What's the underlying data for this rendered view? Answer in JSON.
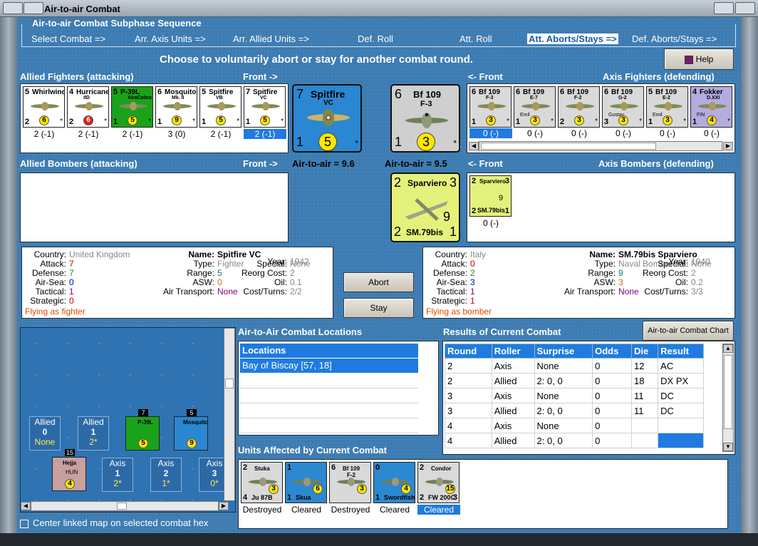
{
  "window": {
    "title": "Air-to-air Combat"
  },
  "sequence": {
    "title": "Air-to-air Combat Subphase Sequence",
    "steps": [
      "Select Combat =>",
      "Arr. Axis Units =>",
      "Arr. Allied Units =>",
      "Def. Roll",
      "Att. Roll",
      "Att. Aborts/Stays =>",
      "Def. Aborts/Stays =>"
    ]
  },
  "prompt": "Choose to voluntarily abort or stay for another combat round.",
  "help_label": "Help",
  "allied_fighters": {
    "title": "Allied Fighters (attacking)",
    "front": "Front ->",
    "units": [
      {
        "tl": "5",
        "name": "Whirlwind",
        "bl": "2",
        "rating": "6",
        "under": "2 (-1)",
        "color": "#ffffff",
        "dot": "yellow"
      },
      {
        "tl": "4",
        "name": "Hurricane",
        "sub": "IID",
        "bl": "2",
        "rating": "6",
        "under": "2 (-1)",
        "color": "#ffffff",
        "dot": "red"
      },
      {
        "tl": "5",
        "name": "P-39L",
        "sub": "AiraCobra",
        "bl": "1",
        "rating": "5",
        "under": "2 (-1)",
        "color": "#1aa31a",
        "dot": "yellow"
      },
      {
        "tl": "6",
        "name": "Mosquito",
        "sub": "Mk. II",
        "bl": "1",
        "rating": "9",
        "under": "3 (0)",
        "color": "#ffffff",
        "dot": "yellow"
      },
      {
        "tl": "5",
        "name": "Spitfire",
        "sub": "VB",
        "bl": "1",
        "rating": "5",
        "under": "2 (-1)",
        "color": "#ffffff",
        "dot": "yellow"
      },
      {
        "tl": "7",
        "name": "Spitfire",
        "sub": "VC",
        "bl": "1",
        "rating": "5",
        "under": "2 (-1)",
        "color": "#ffffff",
        "dot": "yellow"
      }
    ]
  },
  "allied_selected": {
    "tl": "7",
    "name": "Spitfire",
    "sub": "VC",
    "bl": "1",
    "rating": "5",
    "a2a": "Air-to-air = 9.6"
  },
  "axis_selected": {
    "tl": "6",
    "name": "Bf 109",
    "sub": "F-3",
    "bl": "1",
    "rating": "3",
    "a2a": "Air-to-air = 9.5"
  },
  "axis_fighters": {
    "title": "Axis Fighters (defending)",
    "front": "<- Front",
    "units": [
      {
        "tl": "6",
        "name": "Bf 109",
        "sub": "F-3",
        "bl": "1",
        "rating": "3",
        "under": "0 (-)",
        "color": "#d9d9d9"
      },
      {
        "tl": "6",
        "name": "Bf 109",
        "sub": "E-7",
        "extra": "Emil",
        "bl": "1",
        "rating": "3",
        "under": "0 (-)",
        "color": "#d9d9d9"
      },
      {
        "tl": "6",
        "name": "Bf 109",
        "sub": "F-2",
        "bl": "2",
        "rating": "3",
        "under": "0 (-)",
        "color": "#d9d9d9"
      },
      {
        "tl": "6",
        "name": "Bf 109",
        "sub": "G-2",
        "extra": "Gustav",
        "bl": "3",
        "rating": "3",
        "under": "0 (-)",
        "color": "#d9d9d9"
      },
      {
        "tl": "5",
        "name": "Bf 109",
        "sub": "E-2",
        "extra": "Emil",
        "bl": "1",
        "rating": "3",
        "under": "0 (-)",
        "color": "#d9d9d9"
      },
      {
        "tl": "4",
        "name": "Fokker",
        "sub": "D.XXI",
        "extra": "FIN",
        "bl": "1",
        "rating": "4",
        "under": "0 (-)",
        "color": "#b4acdf"
      }
    ]
  },
  "allied_bombers": {
    "title": "Allied Bombers (attacking)",
    "front": "Front ->"
  },
  "axis_bombers": {
    "title": "Axis Bombers (defending)",
    "front": "<- Front",
    "units": [
      {
        "tl": "2",
        "tr": "3",
        "name": "Sparviero",
        "bottom": "SM.79bis",
        "bl": "2",
        "br": "1",
        "rating": "9",
        "under": "0 (-)"
      }
    ]
  },
  "axis_bomber_selected": {
    "tl": "2",
    "tr": "3",
    "name": "Sparviero",
    "bottom": "SM.79bis",
    "bl": "2",
    "br": "1",
    "rating": "9"
  },
  "allied_info": {
    "country_k": "Country:",
    "country": "United Kingdom",
    "attack_k": "Attack:",
    "attack": "7",
    "defense_k": "Defense:",
    "defense": "7",
    "airsea_k": "Air-Sea:",
    "airsea": "0",
    "tactical_k": "Tactical:",
    "tactical": "1",
    "strategic_k": "Strategic:",
    "strategic": "0",
    "mode": "Flying as fighter",
    "name_k": "Name:",
    "name": "Spitfire VC",
    "type_k": "Type:",
    "type": "Fighter",
    "range_k": "Range:",
    "range": "5",
    "asw_k": "ASW:",
    "asw": "0",
    "airtrans_k": "Air Transport:",
    "airtrans": "None",
    "year_k": "Year:",
    "year": "1942",
    "special_k": "Special:",
    "special": "None",
    "reorg_k": "Reorg Cost:",
    "reorg": "2",
    "oil_k": "Oil:",
    "oil": "0.1",
    "cost_k": "Cost/Turns:",
    "cost": "2/2"
  },
  "axis_info": {
    "country_k": "Country:",
    "country": "Italy",
    "attack_k": "Attack:",
    "attack": "0",
    "defense_k": "Defense:",
    "defense": "2",
    "airsea_k": "Air-Sea:",
    "airsea": "3",
    "tactical_k": "Tactical:",
    "tactical": "1",
    "strategic_k": "Strategic:",
    "strategic": "1",
    "mode": "Flying as bomber",
    "name_k": "Name:",
    "name": "SM.79bis Sparviero",
    "type_k": "Type:",
    "type": "Naval Bomber",
    "range_k": "Range:",
    "range": "9",
    "asw_k": "ASW:",
    "asw": "3",
    "airtrans_k": "Air Transport:",
    "airtrans": "None",
    "year_k": "Year:",
    "year": "1940",
    "special_k": "Special:",
    "special": "None",
    "reorg_k": "Reorg Cost:",
    "reorg": "2",
    "oil_k": "Oil:",
    "oil": "0.2",
    "cost_k": "Cost/Turns:",
    "cost": "3/3"
  },
  "abort_label": "Abort",
  "stay_label": "Stay",
  "locations": {
    "title": "Air-to-Air Combat Locations",
    "header": "Locations",
    "rows": [
      "Bay of Biscay [57, 18]"
    ]
  },
  "results": {
    "title": "Results of Current Combat",
    "chart_btn": "Air-to-air Combat Chart",
    "headers": [
      "Round",
      "Roller",
      "Surprise",
      "Odds",
      "Die",
      "Result"
    ],
    "rows": [
      [
        "2",
        "Axis",
        "None",
        "0",
        "12",
        "AC"
      ],
      [
        "2",
        "Allied",
        "2: 0, 0",
        "0",
        "18",
        "DX PX"
      ],
      [
        "3",
        "Axis",
        "None",
        "0",
        "11",
        "DC"
      ],
      [
        "3",
        "Allied",
        "2: 0, 0",
        "0",
        "11",
        "DC"
      ],
      [
        "4",
        "Axis",
        "None",
        "0",
        "",
        ""
      ],
      [
        "4",
        "Allied",
        "2: 0, 0",
        "0",
        "",
        ""
      ]
    ]
  },
  "affected": {
    "title": "Units Affected by Current Combat",
    "units": [
      {
        "tl": "2",
        "name": "Stuka",
        "bottom": "Ju 87B",
        "bl": "4",
        "rating": "3",
        "status": "Destroyed",
        "color": "#d9d9d9"
      },
      {
        "tl": "1",
        "name": "",
        "bottom": "Skua",
        "bl": "1",
        "rating": "6",
        "status": "Cleared",
        "color": "#2c88d0"
      },
      {
        "tl": "6",
        "name": "Bf 109",
        "sub": "F-2",
        "bl": "",
        "rating": "3",
        "status": "Destroyed",
        "color": "#d9d9d9"
      },
      {
        "tl": "0",
        "name": "",
        "bottom": "Swordfish",
        "bl": "1",
        "rating": "4",
        "status": "Cleared",
        "color": "#2c88d0"
      },
      {
        "tl": "2",
        "name": "Condor",
        "bottom": "FW 200C",
        "bl": "2",
        "br": "3",
        "rating": "15",
        "status": "Cleared",
        "color": "#d9d9d9"
      }
    ]
  },
  "map": {
    "tiles": [
      {
        "side": "Allied",
        "num": "0",
        "sub": "None"
      },
      {
        "side": "Allied",
        "num": "1",
        "sub": "2*"
      },
      {
        "side": "Axis",
        "num": "1",
        "sub": "2*"
      },
      {
        "side": "Axis",
        "num": "2",
        "sub": "1*"
      },
      {
        "side": "Axis",
        "num": "3",
        "sub": "0*"
      }
    ],
    "stack1": "7",
    "stack2": "5",
    "stack3": "15",
    "unit1": "P-39L",
    "unit1_r": "5",
    "unit2": "Mosquito",
    "unit2_r": "9",
    "unit3": "Hejja",
    "unit3_r": "4",
    "unit3_c": "HUN"
  },
  "center_linked": "Center linked map on selected combat hex"
}
